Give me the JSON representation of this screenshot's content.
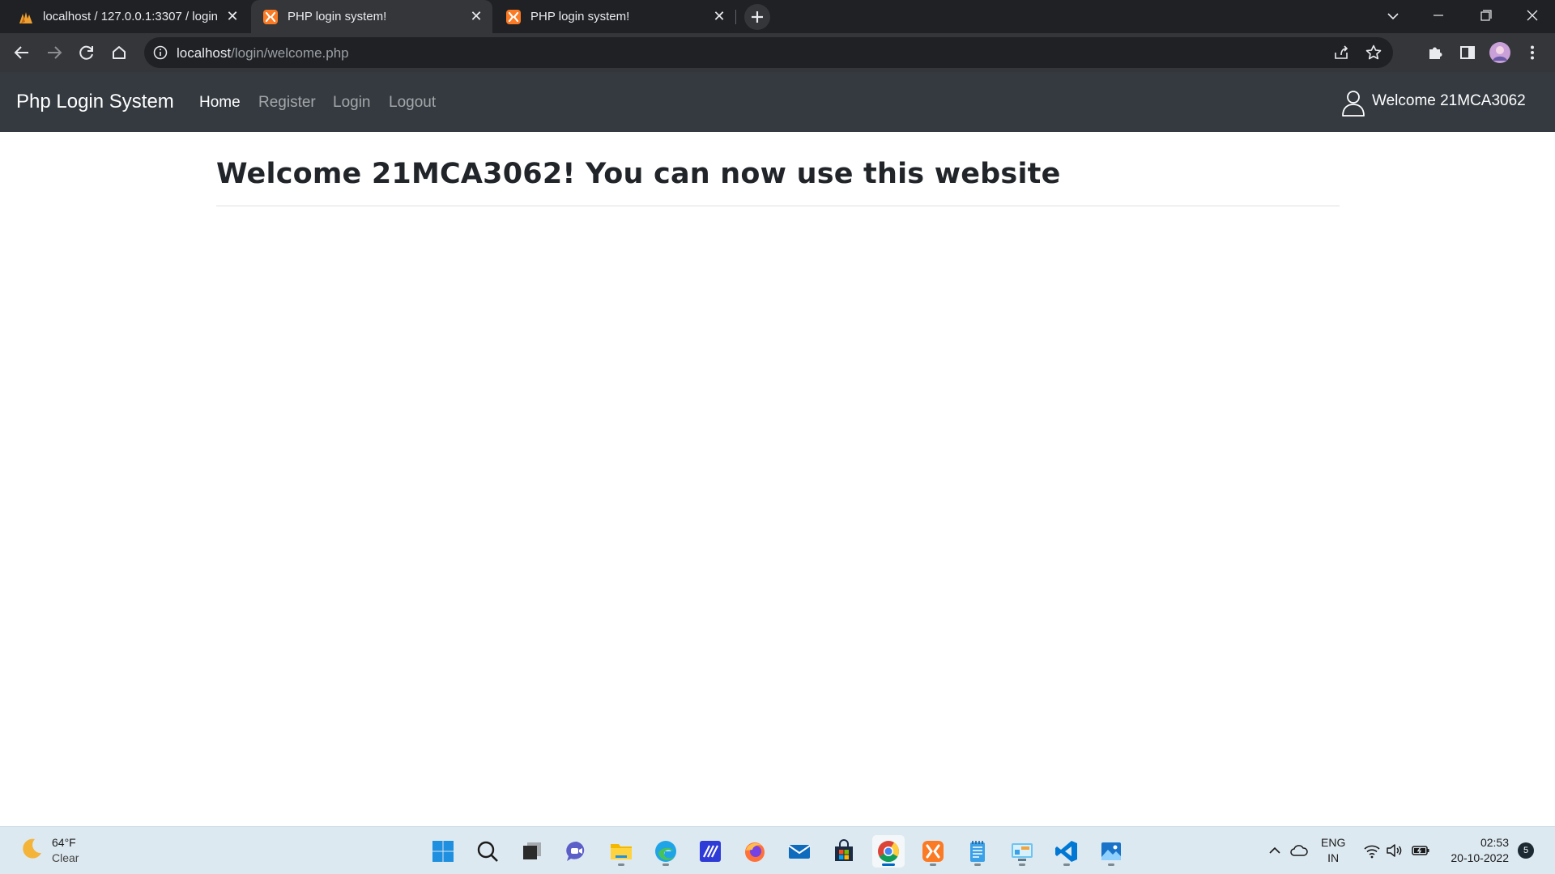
{
  "browser": {
    "tabs": [
      {
        "title": "localhost / 127.0.0.1:3307 / login",
        "icon": "phpmyadmin-icon"
      },
      {
        "title": "PHP login system!",
        "icon": "xampp-icon"
      },
      {
        "title": "PHP login system!",
        "icon": "xampp-icon"
      }
    ],
    "active_tab": 1,
    "url_host": "localhost",
    "url_path": "/login/welcome.php"
  },
  "navbar": {
    "brand": "Php Login System",
    "links": [
      "Home",
      "Register",
      "Login",
      "Logout"
    ],
    "active_link": "Home",
    "user_greeting": "Welcome 21MCA3062"
  },
  "main": {
    "heading": "Welcome 21MCA3062! You can now use this website"
  },
  "taskbar": {
    "weather_temp": "64°F",
    "weather_condition": "Clear",
    "apps": [
      "start",
      "search",
      "task-view",
      "teams-chat",
      "file-explorer",
      "edge",
      "linear-app",
      "firefox",
      "mail",
      "microsoft-store",
      "chrome",
      "xampp",
      "notepad",
      "control-panel",
      "vscode",
      "photos"
    ],
    "lang_top": "ENG",
    "lang_bottom": "IN",
    "time": "02:53",
    "date": "20-10-2022",
    "notifications": "5"
  },
  "colors": {
    "tabstrip_bg": "#202124",
    "toolbar_bg": "#35363a",
    "navbar_bg": "#343a40",
    "taskbar_bg": "#dde9f1",
    "heading_text": "#212529"
  }
}
